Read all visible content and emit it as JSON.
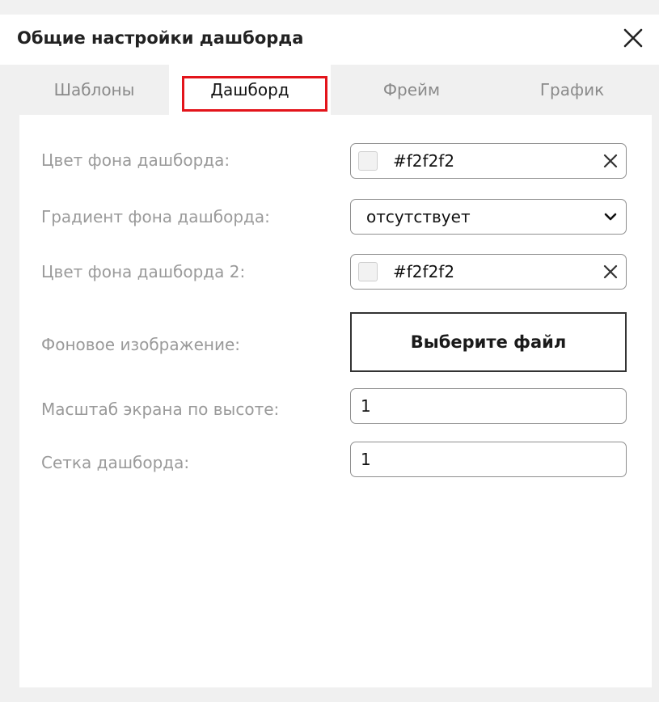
{
  "dialog": {
    "title": "Общие настройки дашборда",
    "close_icon": "close-icon"
  },
  "tabs": [
    {
      "label": "Шаблоны",
      "active": false
    },
    {
      "label": "Дашборд",
      "active": true
    },
    {
      "label": "Фрейм",
      "active": false
    },
    {
      "label": "График",
      "active": false
    }
  ],
  "form": {
    "bg_color": {
      "label": "Цвет фона дашборда:",
      "value": "#f2f2f2",
      "swatch_color": "#f2f2f2",
      "clear_icon": "clear-icon"
    },
    "bg_gradient": {
      "label": "Градиент фона дашборда:",
      "value": "отсутствует",
      "icon": "chevron-down-icon"
    },
    "bg_color_2": {
      "label": "Цвет фона дашборда 2:",
      "value": "#f2f2f2",
      "swatch_color": "#f2f2f2",
      "clear_icon": "clear-icon"
    },
    "bg_image": {
      "label": "Фоновое изображение:",
      "button_label": "Выберите файл"
    },
    "height_scale": {
      "label": "Масштаб экрана по высоте:",
      "value": "1"
    },
    "grid": {
      "label": "Сетка дашборда:",
      "value": "1"
    }
  },
  "colors": {
    "accent_outline": "#e3141b",
    "label_gray": "#9a9a9a",
    "dialog_bg": "#f0f0f0"
  }
}
